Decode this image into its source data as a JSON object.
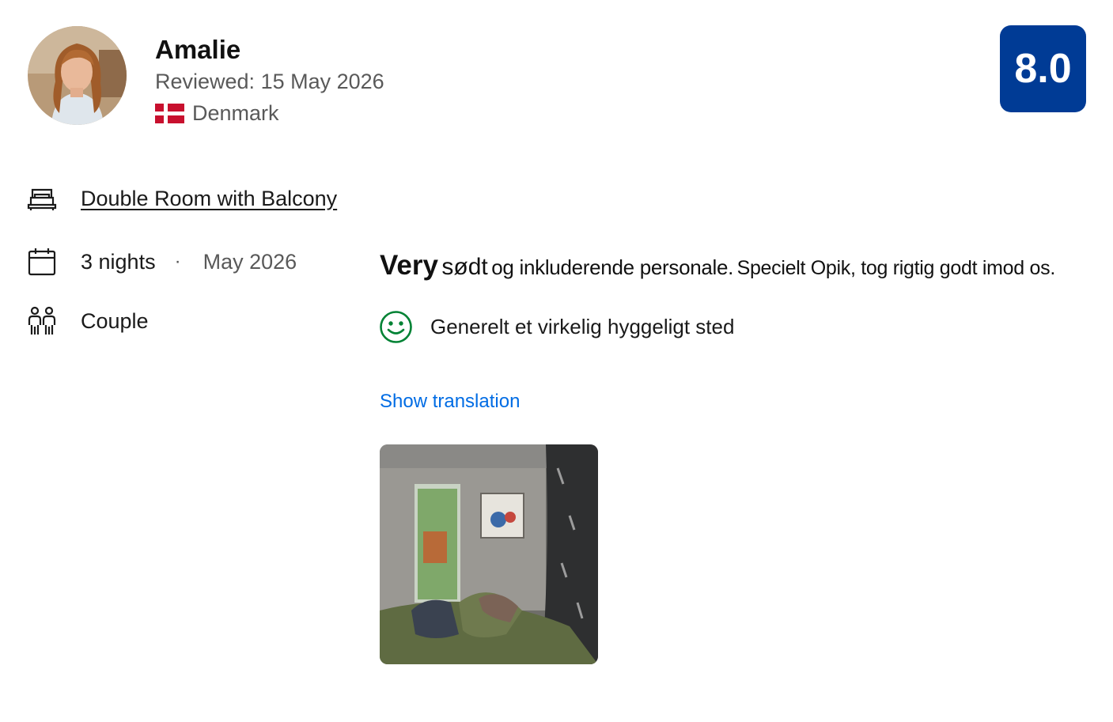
{
  "reviewer": {
    "name": "Amalie",
    "reviewed": "Reviewed: 15 May 2026",
    "country": "Denmark",
    "flag_icon": "denmark-flag-icon",
    "avatar_icon": "avatar-photo"
  },
  "score": "8.0",
  "stay": {
    "room": "Double Room with Balcony",
    "nights": "3 nights",
    "separator": "·",
    "month": "May 2026",
    "traveler_type": "Couple"
  },
  "review": {
    "headline_1": "Very",
    "headline_2": "sødt",
    "headline_3": "og inkluderende personale.",
    "headline_4": "Specielt Opik, tog rigtig godt imod os.",
    "positive": "Generelt et virkelig hyggeligt sted",
    "show_translation": "Show translation"
  },
  "colors": {
    "score_badge": "#003b95",
    "link": "#006ce4",
    "positive_icon": "#008234",
    "flag_red": "#c8102e"
  }
}
